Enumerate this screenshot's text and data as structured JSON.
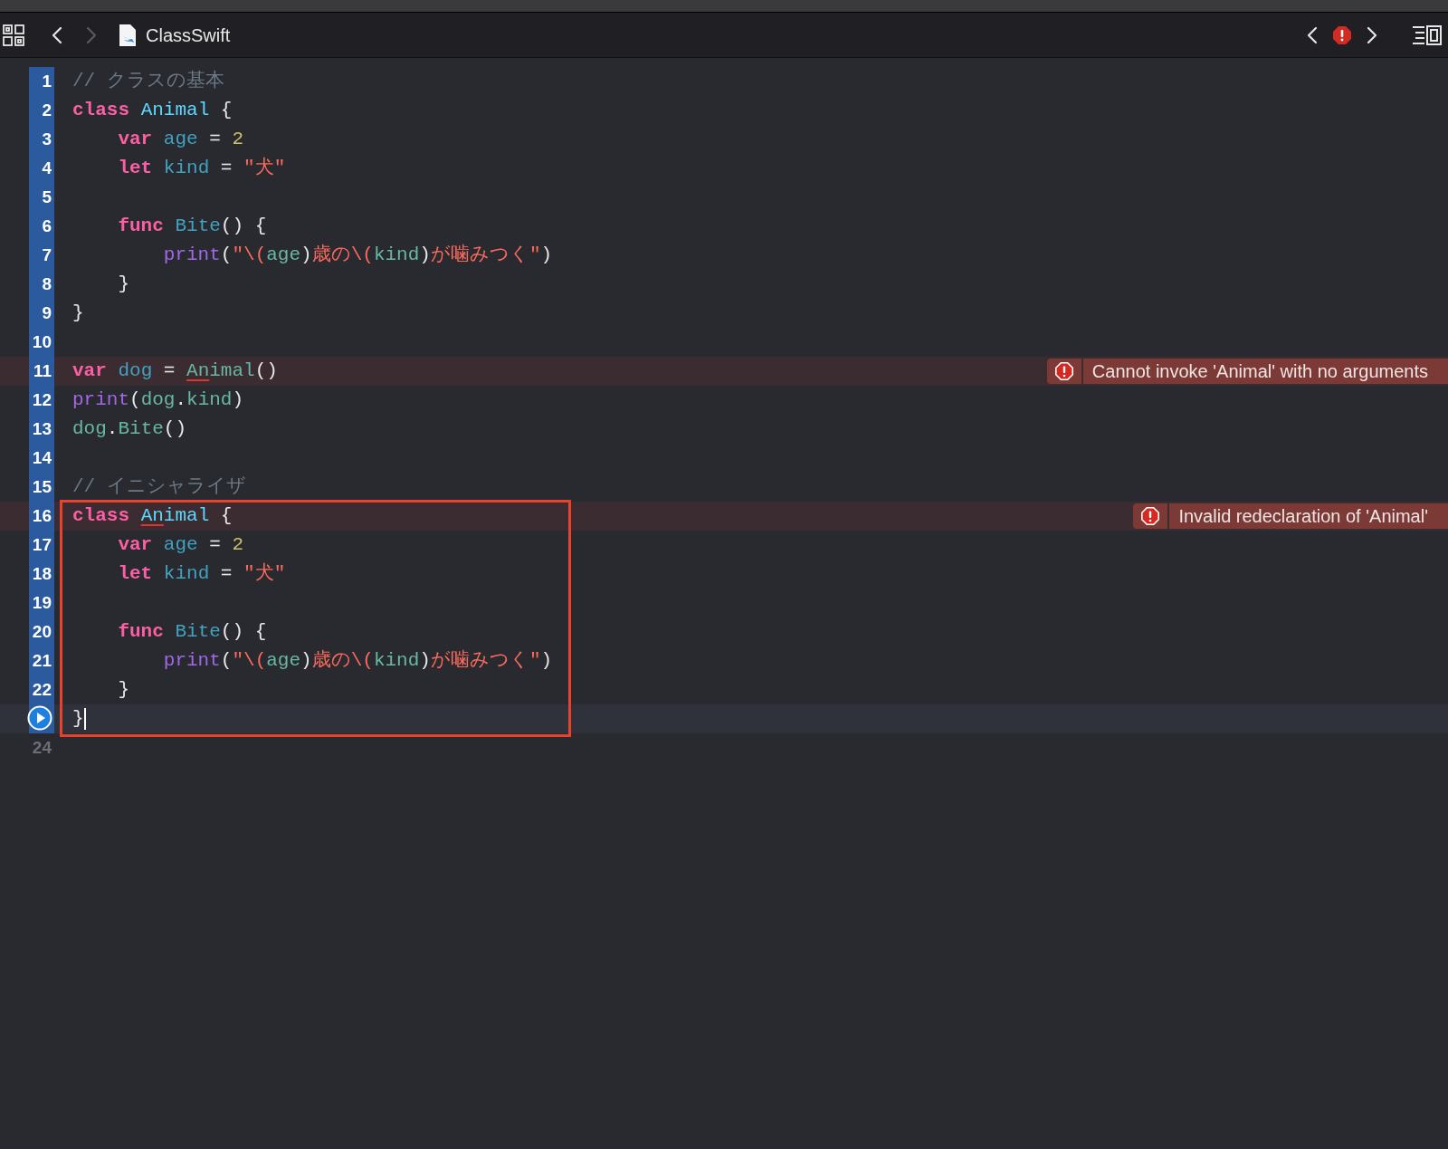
{
  "toolbar": {
    "back_enabled": true,
    "forward_enabled": false,
    "file_name": "ClassSwift",
    "issue_back_enabled": true,
    "issue_forward_enabled": true
  },
  "lines": [
    {
      "number": "1",
      "executed": true,
      "tokens": [
        {
          "text": "// クラスの基本",
          "kind": "comment"
        }
      ]
    },
    {
      "number": "2",
      "executed": true,
      "tokens": [
        {
          "text": "class ",
          "kind": "keyword"
        },
        {
          "text": "Animal",
          "kind": "type"
        },
        {
          "text": " {",
          "kind": "plain"
        }
      ]
    },
    {
      "number": "3",
      "executed": true,
      "tokens": [
        {
          "text": "    var ",
          "kind": "keyword"
        },
        {
          "text": "age",
          "kind": "decl"
        },
        {
          "text": " = ",
          "kind": "plain"
        },
        {
          "text": "2",
          "kind": "number"
        }
      ]
    },
    {
      "number": "4",
      "executed": true,
      "tokens": [
        {
          "text": "    let ",
          "kind": "keyword"
        },
        {
          "text": "kind",
          "kind": "decl"
        },
        {
          "text": " = ",
          "kind": "plain"
        },
        {
          "text": "\"犬\"",
          "kind": "string"
        }
      ]
    },
    {
      "number": "5",
      "executed": true
    },
    {
      "number": "6",
      "executed": true,
      "tokens": [
        {
          "text": "    func ",
          "kind": "keyword"
        },
        {
          "text": "Bite",
          "kind": "decl"
        },
        {
          "text": "() {",
          "kind": "plain"
        }
      ]
    },
    {
      "number": "7",
      "executed": true,
      "tokens": [
        {
          "text": "        print",
          "kind": "func"
        },
        {
          "text": "(",
          "kind": "plain"
        },
        {
          "text": "\"\\(",
          "kind": "string"
        },
        {
          "text": "age",
          "kind": "ident"
        },
        {
          "text": ")",
          "kind": "plain"
        },
        {
          "text": "歳の\\(",
          "kind": "string"
        },
        {
          "text": "kind",
          "kind": "ident"
        },
        {
          "text": ")",
          "kind": "plain"
        },
        {
          "text": "が噛みつく\"",
          "kind": "string"
        },
        {
          "text": ")",
          "kind": "plain"
        }
      ]
    },
    {
      "number": "8",
      "executed": true,
      "tokens": [
        {
          "text": "    }",
          "kind": "plain"
        }
      ]
    },
    {
      "number": "9",
      "executed": true,
      "tokens": [
        {
          "text": "}",
          "kind": "plain"
        }
      ]
    },
    {
      "number": "10",
      "executed": true
    },
    {
      "number": "11",
      "executed": true,
      "error": "Cannot invoke 'Animal' with no arguments",
      "tokens": [
        {
          "text": "var ",
          "kind": "keyword"
        },
        {
          "text": "dog",
          "kind": "decl"
        },
        {
          "text": " = ",
          "kind": "plain"
        },
        {
          "text": "An",
          "kind": "ident",
          "underlined": true
        },
        {
          "text": "imal",
          "kind": "ident"
        },
        {
          "text": "()",
          "kind": "plain"
        }
      ]
    },
    {
      "number": "12",
      "executed": true,
      "tokens": [
        {
          "text": "print",
          "kind": "func"
        },
        {
          "text": "(",
          "kind": "plain"
        },
        {
          "text": "dog",
          "kind": "ident"
        },
        {
          "text": ".",
          "kind": "plain"
        },
        {
          "text": "kind",
          "kind": "ident"
        },
        {
          "text": ")",
          "kind": "plain"
        }
      ]
    },
    {
      "number": "13",
      "executed": true,
      "tokens": [
        {
          "text": "dog",
          "kind": "ident"
        },
        {
          "text": ".",
          "kind": "plain"
        },
        {
          "text": "Bite",
          "kind": "ident"
        },
        {
          "text": "()",
          "kind": "plain"
        }
      ]
    },
    {
      "number": "14",
      "executed": true
    },
    {
      "number": "15",
      "executed": true,
      "tokens": [
        {
          "text": "// イニシャライザ",
          "kind": "comment"
        }
      ]
    },
    {
      "number": "16",
      "executed": true,
      "boxed": true,
      "error": "Invalid redeclaration of 'Animal'",
      "tokens": [
        {
          "text": "class ",
          "kind": "keyword"
        },
        {
          "text": "An",
          "kind": "type",
          "underlined": true
        },
        {
          "text": "imal",
          "kind": "type"
        },
        {
          "text": " {",
          "kind": "plain"
        }
      ]
    },
    {
      "number": "17",
      "executed": true,
      "boxed": true,
      "tokens": [
        {
          "text": "    var ",
          "kind": "keyword"
        },
        {
          "text": "age",
          "kind": "decl"
        },
        {
          "text": " = ",
          "kind": "plain"
        },
        {
          "text": "2",
          "kind": "number"
        }
      ]
    },
    {
      "number": "18",
      "executed": true,
      "boxed": true,
      "tokens": [
        {
          "text": "    let ",
          "kind": "keyword"
        },
        {
          "text": "kind",
          "kind": "decl"
        },
        {
          "text": " = ",
          "kind": "plain"
        },
        {
          "text": "\"犬\"",
          "kind": "string"
        }
      ]
    },
    {
      "number": "19",
      "executed": true,
      "boxed": true
    },
    {
      "number": "20",
      "executed": true,
      "boxed": true,
      "tokens": [
        {
          "text": "    func ",
          "kind": "keyword"
        },
        {
          "text": "Bite",
          "kind": "decl"
        },
        {
          "text": "() {",
          "kind": "plain"
        }
      ]
    },
    {
      "number": "21",
      "executed": true,
      "boxed": true,
      "tokens": [
        {
          "text": "        print",
          "kind": "func"
        },
        {
          "text": "(",
          "kind": "plain"
        },
        {
          "text": "\"\\(",
          "kind": "string"
        },
        {
          "text": "age",
          "kind": "ident"
        },
        {
          "text": ")",
          "kind": "plain"
        },
        {
          "text": "歳の\\(",
          "kind": "string"
        },
        {
          "text": "kind",
          "kind": "ident"
        },
        {
          "text": ")",
          "kind": "plain"
        },
        {
          "text": "が噛みつく\"",
          "kind": "string"
        },
        {
          "text": ")",
          "kind": "plain"
        }
      ]
    },
    {
      "number": "22",
      "executed": true,
      "boxed": true,
      "tokens": [
        {
          "text": "    }",
          "kind": "plain"
        }
      ]
    },
    {
      "run_marker": true,
      "executed": true,
      "boxed": true,
      "current": true,
      "tokens": [
        {
          "text": "}",
          "kind": "plain"
        }
      ]
    },
    {
      "number": "24",
      "executed": false
    }
  ]
}
